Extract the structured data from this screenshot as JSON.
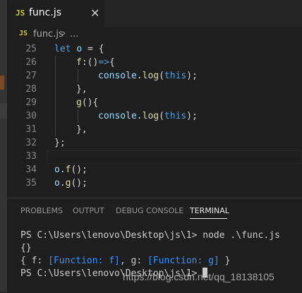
{
  "tab": {
    "icon": "JS",
    "label": "func.js",
    "close": "✕"
  },
  "breadcrumb": {
    "icon": "JS",
    "file": "func.js",
    "sep": "›",
    "more": "..."
  },
  "editor": {
    "lines": [
      {
        "num": "25",
        "code": "let o = {"
      },
      {
        "num": "26",
        "code": "f:()=>{"
      },
      {
        "num": "27",
        "code": "console.log(this);"
      },
      {
        "num": "28",
        "code": "},"
      },
      {
        "num": "29",
        "code": "g(){"
      },
      {
        "num": "30",
        "code": "console.log(this);"
      },
      {
        "num": "31",
        "code": "},"
      },
      {
        "num": "32",
        "code": "};"
      },
      {
        "num": "33",
        "code": ""
      },
      {
        "num": "34",
        "code": "o.f();"
      },
      {
        "num": "35",
        "code": "o.g();"
      }
    ]
  },
  "panel": {
    "tabs": [
      "PROBLEMS",
      "OUTPUT",
      "DEBUG CONSOLE",
      "TERMINAL"
    ],
    "active_tab": "TERMINAL",
    "terminal": {
      "prompt1": "PS C:\\Users\\lenovo\\Desktop\\js\\1> node .\\func.js",
      "out1": "{}",
      "out2_a": "{ f: ",
      "out2_b": "[Function: f]",
      "out2_c": ", g: ",
      "out2_d": "[Function: g]",
      "out2_e": " }",
      "prompt2": "PS C:\\Users\\lenovo\\Desktop\\js\\1> "
    }
  },
  "watermark": "https://blog.csdn.net/qq_18138105",
  "colors": {
    "keyword": "#569cd6",
    "variable": "#9cdcfe",
    "function": "#dcdcaa",
    "js_icon": "#cbcb41"
  }
}
